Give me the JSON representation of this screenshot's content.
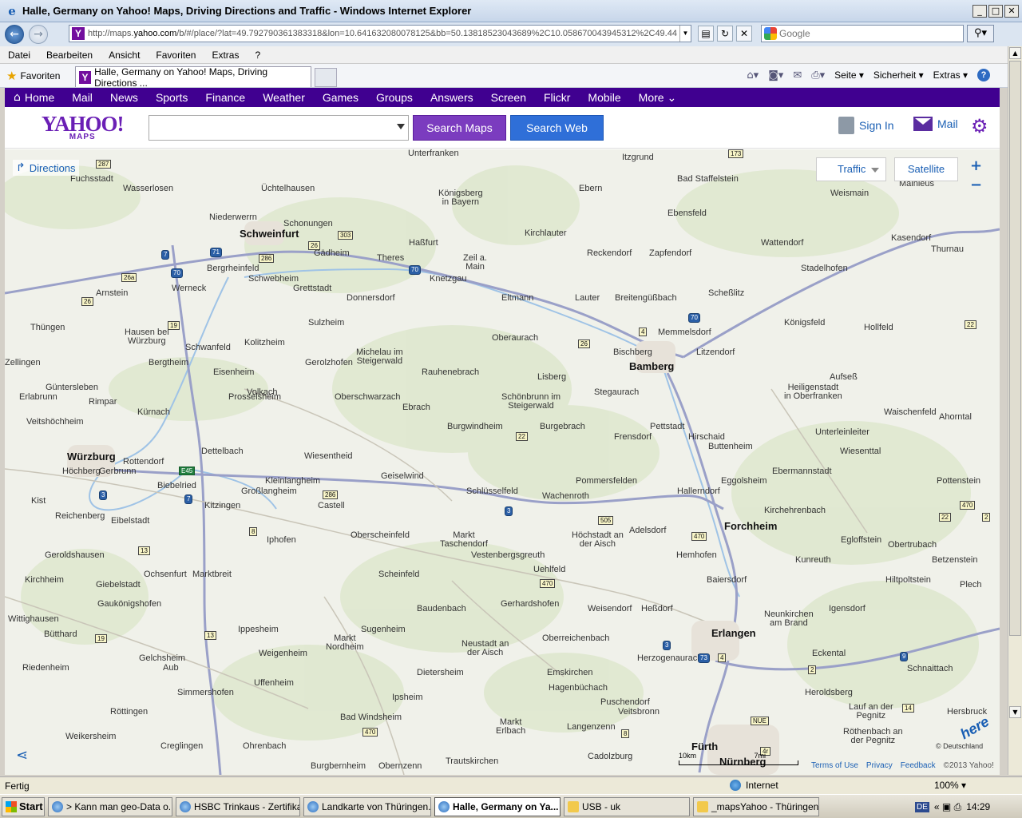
{
  "window": {
    "title": "Halle, Germany on Yahoo! Maps, Driving Directions and Traffic - Windows Internet Explorer"
  },
  "address": {
    "url_prefix": "http://maps.",
    "url_domain": "yahoo.com",
    "url_rest": "/b/#/place/?lat=49.792790361383318&lon=10.641632080078125&bb=50.13818523043689%2C10.058670043945312%2C49.44"
  },
  "search": {
    "placeholder": "Google"
  },
  "menu": {
    "items": [
      "Datei",
      "Bearbeiten",
      "Ansicht",
      "Favoriten",
      "Extras",
      "?"
    ]
  },
  "favbar": {
    "favorites_label": "Favoriten",
    "tab_title": "Halle, Germany on Yahoo! Maps, Driving Directions ...",
    "seite": "Seite",
    "sicherheit": "Sicherheit",
    "extras": "Extras"
  },
  "ynav": {
    "home": "Home",
    "items": [
      "Mail",
      "News",
      "Sports",
      "Finance",
      "Weather",
      "Games",
      "Groups",
      "Answers",
      "Screen",
      "Flickr",
      "Mobile"
    ],
    "more": "More"
  },
  "yhead": {
    "logo": "YAHOO!",
    "logo_sub": "MAPS",
    "search_value": "",
    "search_maps": "Search Maps",
    "search_web": "Search Web",
    "sign_in": "Sign In",
    "mail": "Mail"
  },
  "map": {
    "directions": "Directions",
    "traffic": "Traffic",
    "satellite": "Satellite",
    "copyright": "© Deutschland",
    "here": "here",
    "scale_labels": [
      "10km",
      "7mi"
    ],
    "footer": {
      "terms": "Terms of Use",
      "privacy": "Privacy",
      "feedback": "Feedback",
      "copy": "©2013 Yahoo!"
    },
    "places": [
      "Unterfranken",
      "Itzgrund",
      "Bad Staffelstein",
      "Weismain",
      "Mainleus",
      "Fuchsstadt",
      "Wasserlosen",
      "Üchtelhausen",
      "Königsberg\nin Bayern",
      "Ebern",
      "Ebensfeld",
      "Niederwerrn",
      "Schonungen",
      "Schweinfurt",
      "Haßfurt",
      "Kirchlauter",
      "Wattendorf",
      "Kasendorf",
      "Thurnau",
      "Bergrheinfeld",
      "Gädheim",
      "Theres",
      "Zeil a.\nMain",
      "Reckendorf",
      "Zapfendorf",
      "Stadelhofen",
      "Schwebheim",
      "Knetzgau",
      "Arnstein",
      "Werneck",
      "Grettstadt",
      "Donnersdorf",
      "Eltmann",
      "Lauter",
      "Breitengüßbach",
      "Scheßlitz",
      "Sulzheim",
      "Memmelsdorf",
      "Königsfeld",
      "Hollfeld",
      "Thüngen",
      "Hausen bei\nWürzburg",
      "Oberaurach",
      "Kolitzheim",
      "Schwanfeld",
      "Bischberg",
      "Litzendorf",
      "Michelau im\nSteigerwald",
      "Bamberg",
      "Zellingen",
      "Bergtheim",
      "Gerolzhofen",
      "Eisenheim",
      "Rauhenebrach",
      "Lisberg",
      "Aufseß",
      "Güntersleben",
      "Volkach",
      "Stegaurach",
      "Heiligenstadt\nin Oberfranken",
      "Erlabrunn",
      "Prosselsheim",
      "Oberschwarzach",
      "Schönbrunn im\nSteigerwald",
      "Rimpar",
      "Ebrach",
      "Waischenfeld",
      "Kürnach",
      "Veitshöchheim",
      "Pettstadt",
      "Ahorntal",
      "Burgwindheim",
      "Burgebrach",
      "Hirschaid",
      "Unterleinleiter",
      "Frensdorf",
      "Dettelbach",
      "Buttenheim",
      "Würzburg",
      "Wiesentheid",
      "Wiesenttal",
      "Rottendorf",
      "Höchberg",
      "Gerbrunn",
      "Geiselwind",
      "Kleinlangheim",
      "Pommersfelden",
      "Eggolsheim",
      "Ebermannstadt",
      "Pottenstein",
      "Biebelried",
      "Großlangheim",
      "Schlüsselfeld",
      "Wachenroth",
      "Hallerndorf",
      "Kist",
      "Kitzingen",
      "Castell",
      "Kirchehrenbach",
      "Reichenberg",
      "Eibelstadt",
      "Forchheim",
      "Adelsdorf",
      "Oberscheinfeld",
      "Markt\nTaschendorf",
      "Höchstadt an\nder Aisch",
      "Egloffstein",
      "Obertrubach",
      "Iphofen",
      "Vestenbergsgreuth",
      "Hemhofen",
      "Geroldshausen",
      "Kunreuth",
      "Betzenstein",
      "Ochsenfurt",
      "Marktbreit",
      "Uehlfeld",
      "Scheinfeld",
      "Kirchheim",
      "Baiersdorf",
      "Hiltpoltstein",
      "Giebelstadt",
      "Plech",
      "Gaukönigshofen",
      "Gerhardshofen",
      "Baudenbach",
      "Weisendorf",
      "Heßdorf",
      "Igensdorf",
      "Neunkirchen\nam Brand",
      "Wittighausen",
      "Ippesheim",
      "Sugenheim",
      "Erlangen",
      "Bütthard",
      "Markt\nNordheim",
      "Oberreichenbach",
      "Neustadt an\nder Aisch",
      "Weigenheim",
      "Eckental",
      "Gelchsheim",
      "Herzogenaurach",
      "Schnaittach",
      "Riedenheim",
      "Aub",
      "Dietersheim",
      "Emskirchen",
      "Uffenheim",
      "Hagenbüchach",
      "Heroldsberg",
      "Simmershofen",
      "Ipsheim",
      "Puschendorf",
      "Röttingen",
      "Veitsbronn",
      "Lauf an der\nPegnitz",
      "Hersbruck",
      "Bad Windsheim",
      "Markt\nErlbach",
      "Langenzenn",
      "Weikersheim",
      "Röthenbach an\nder Pegnitz",
      "Creglingen",
      "Ohrenbach",
      "Fürth",
      "Cadolzburg",
      "Burgbernheim",
      "Obernzenn",
      "Trautskirchen",
      "Nürnberg"
    ],
    "shields": [
      "287",
      "173",
      "303",
      "26",
      "7",
      "71",
      "286",
      "70",
      "70",
      "26a",
      "26",
      "19",
      "4",
      "70",
      "22",
      "26",
      "22",
      "22",
      "E45",
      "7",
      "286",
      "3",
      "3",
      "505",
      "470",
      "8",
      "13",
      "470",
      "470",
      "2",
      "13",
      "19",
      "3",
      "73",
      "4",
      "9",
      "2",
      "14",
      "470",
      "8",
      "NUE",
      "4r"
    ]
  },
  "status": {
    "text": "Fertig",
    "zone": "Internet",
    "zoom": "100%"
  },
  "taskbar": {
    "start": "Start",
    "tasks": [
      "> Kann man geo-Data o...",
      "HSBC Trinkaus - Zertifika...",
      "Landkarte von Thüringen...",
      "Halle, Germany on Ya...",
      "USB - uk",
      "_mapsYahoo - Thüringen..."
    ],
    "lang": "DE",
    "time": "14:29"
  },
  "colors": {
    "yahoo_purple": "#400090",
    "search_maps": "#7b3cbf",
    "search_web": "#2f6fd8",
    "link_blue": "#1a5fb4",
    "motorway": "#9aa0c8",
    "river": "#9fc3e6"
  }
}
